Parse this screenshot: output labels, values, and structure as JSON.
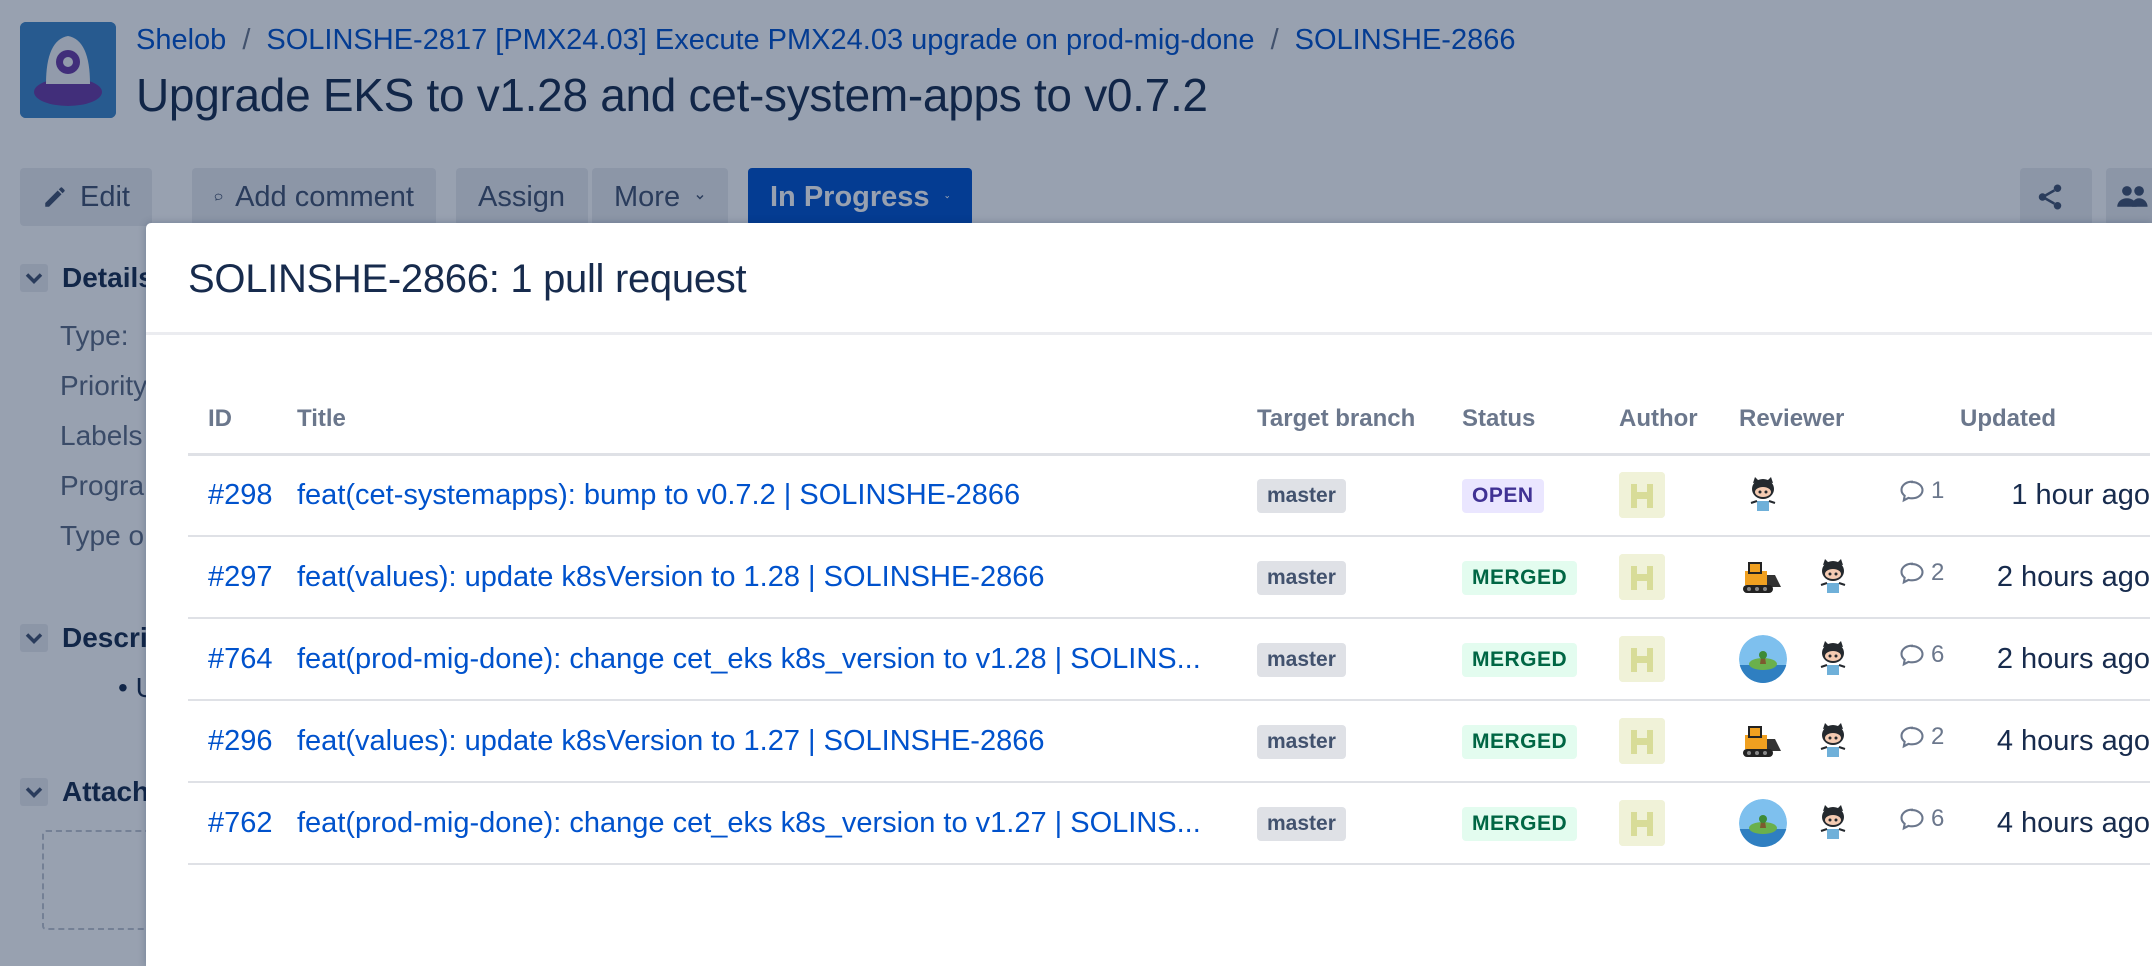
{
  "breadcrumb": {
    "project": "Shelob",
    "parent": "SOLINSHE-2817 [PMX24.03] Execute PMX24.03 upgrade on prod-mig-done",
    "issue": "SOLINSHE-2866"
  },
  "issue_title": "Upgrade EKS to v1.28 and cet-system-apps to v0.7.2",
  "toolbar": {
    "edit": "Edit",
    "add_comment": "Add comment",
    "assign": "Assign",
    "more": "More",
    "status": "In Progress"
  },
  "side": {
    "details": "Details",
    "fields": [
      "Type:",
      "Priority",
      "Labels",
      "Progra",
      "Type o"
    ],
    "description": "Descri",
    "description_bullet": "U",
    "attachments": "Attach"
  },
  "dialog": {
    "title": "SOLINSHE-2866: 1 pull request",
    "columns": {
      "id": "ID",
      "title": "Title",
      "target_branch": "Target branch",
      "status": "Status",
      "author": "Author",
      "reviewer": "Reviewer",
      "updated": "Updated"
    },
    "rows": [
      {
        "id": "#298",
        "title": "feat(cet-systemapps): bump to v0.7.2 | SOLINSHE-2866",
        "branch": "master",
        "status": "OPEN",
        "reviewers": [
          "octocat"
        ],
        "comments": "1",
        "updated": "1 hour ago"
      },
      {
        "id": "#297",
        "title": "feat(values): update k8sVersion to 1.28 | SOLINSHE-2866",
        "branch": "master",
        "status": "MERGED",
        "reviewers": [
          "bulldozer",
          "octocat"
        ],
        "comments": "2",
        "updated": "2 hours ago"
      },
      {
        "id": "#764",
        "title": "feat(prod-mig-done): change cet_eks k8s_version to v1.28 | SOLINS...",
        "branch": "master",
        "status": "MERGED",
        "reviewers": [
          "island",
          "octocat"
        ],
        "comments": "6",
        "updated": "2 hours ago"
      },
      {
        "id": "#296",
        "title": "feat(values): update k8sVersion to 1.27 | SOLINSHE-2866",
        "branch": "master",
        "status": "MERGED",
        "reviewers": [
          "bulldozer",
          "octocat"
        ],
        "comments": "2",
        "updated": "4 hours ago"
      },
      {
        "id": "#762",
        "title": "feat(prod-mig-done): change cet_eks k8s_version to v1.27 | SOLINS...",
        "branch": "master",
        "status": "MERGED",
        "reviewers": [
          "island",
          "octocat"
        ],
        "comments": "6",
        "updated": "4 hours ago"
      }
    ]
  },
  "colors": {
    "link": "#0052cc",
    "primary_button": "#0052cc",
    "open_lozenge": "#eae6ff",
    "merged_lozenge": "#e3fcef",
    "overlay": "#091e42"
  }
}
